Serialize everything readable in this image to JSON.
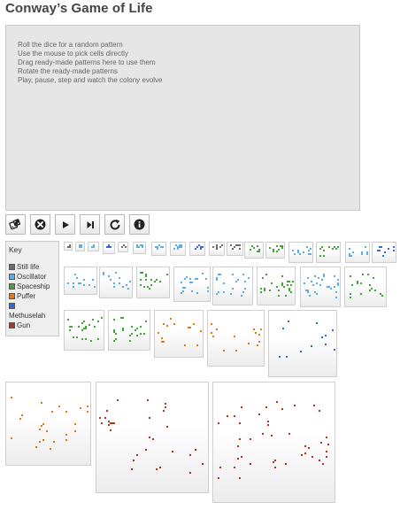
{
  "app": {
    "title": "Conway’s Game of Life"
  },
  "instructions": [
    "Roll the dice for a random pattern",
    "Use the mouse to pick cells directly",
    "Drag ready-made patterns here to use them",
    "Rotate the ready-made patterns",
    "Play, pause, step and watch the colony evolve"
  ],
  "toolbar": [
    "dice-icon",
    "clear-icon",
    "play-icon",
    "step-icon",
    "rotate-icon",
    "info-icon"
  ],
  "key": {
    "title": "Key",
    "items": [
      {
        "label": "Still life",
        "color": "#6b6b6b"
      },
      {
        "label": "Oscillator",
        "color": "#5aaee8"
      },
      {
        "label": "Spaceship",
        "color": "#3fa63a"
      },
      {
        "label": "Puffer",
        "color": "#e07b14"
      },
      {
        "label": "",
        "color": "#2f6bd6"
      },
      {
        "label": "Methuselah",
        "color": ""
      },
      {
        "label": "Gun",
        "color": "#b3361b"
      }
    ]
  },
  "pattern_categories": [
    "still-life",
    "oscillator",
    "spaceship",
    "puffer",
    "methuselah",
    "gun"
  ]
}
